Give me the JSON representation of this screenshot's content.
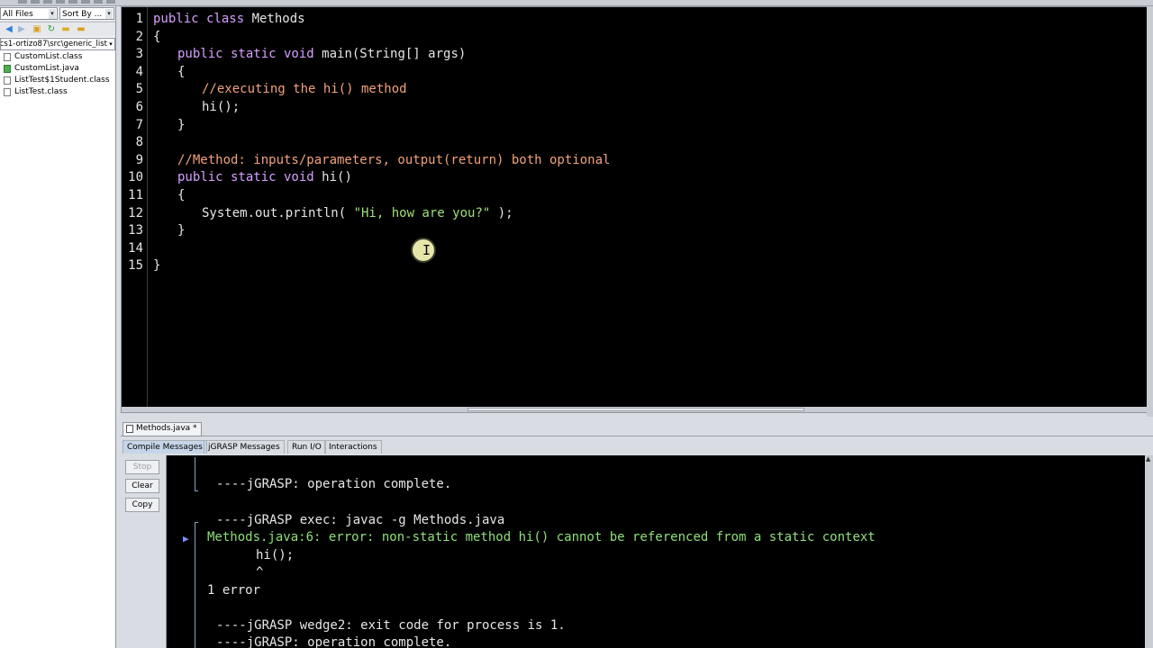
{
  "browse": {
    "filter_combo": "All Files",
    "sort_combo": "Sort By ...",
    "path": "cs1-ortizo87\\src\\generic_list",
    "files": [
      {
        "name": "CustomList.class",
        "type": "class"
      },
      {
        "name": "CustomList.java",
        "type": "java"
      },
      {
        "name": "ListTest$1Student.class",
        "type": "class"
      },
      {
        "name": "ListTest.class",
        "type": "class"
      }
    ]
  },
  "editor": {
    "line_numbers": [
      "1",
      "2",
      "3",
      "4",
      "5",
      "6",
      "7",
      "8",
      "9",
      "10",
      "11",
      "12",
      "13",
      "14",
      "15"
    ],
    "code": {
      "l1_kw": "public class ",
      "l1_rest": "Methods",
      "l2": "{",
      "l3_kw": "public static void ",
      "l3_rest": "main(String[] args)",
      "l4": "{",
      "l5": "//executing the hi() method",
      "l6": "hi();",
      "l7": "}",
      "l9": "//Method: inputs/parameters, output(return) both optional",
      "l10_kw": "public static void ",
      "l10_rest": "hi()",
      "l11": "{",
      "l12_a": "System.out.println( ",
      "l12_str": "\"Hi, how are you?\"",
      "l12_b": " );",
      "l13": "}",
      "l15": "}"
    }
  },
  "doc_tab": {
    "label": "Methods.java *"
  },
  "message_tabs": [
    "Compile Messages",
    "jGRASP Messages",
    "Run I/O",
    "Interactions"
  ],
  "message_buttons": {
    "stop": "Stop",
    "clear": "Clear",
    "copy": "Copy"
  },
  "console": {
    "line1": "----jGRASP: operation complete.",
    "line2": "----jGRASP exec: javac -g Methods.java",
    "error": "Methods.java:6: error: non-static method hi() cannot be referenced from a static context",
    "code_line": "hi();",
    "caret": "^",
    "count": "1 error",
    "exit": "----jGRASP wedge2: exit code for process is 1.",
    "complete": "----jGRASP: operation complete."
  },
  "colors": {
    "keyword": "#d6a0ff",
    "comment": "#f2a27a",
    "string": "#9fe07a",
    "editor_bg": "#000000"
  }
}
